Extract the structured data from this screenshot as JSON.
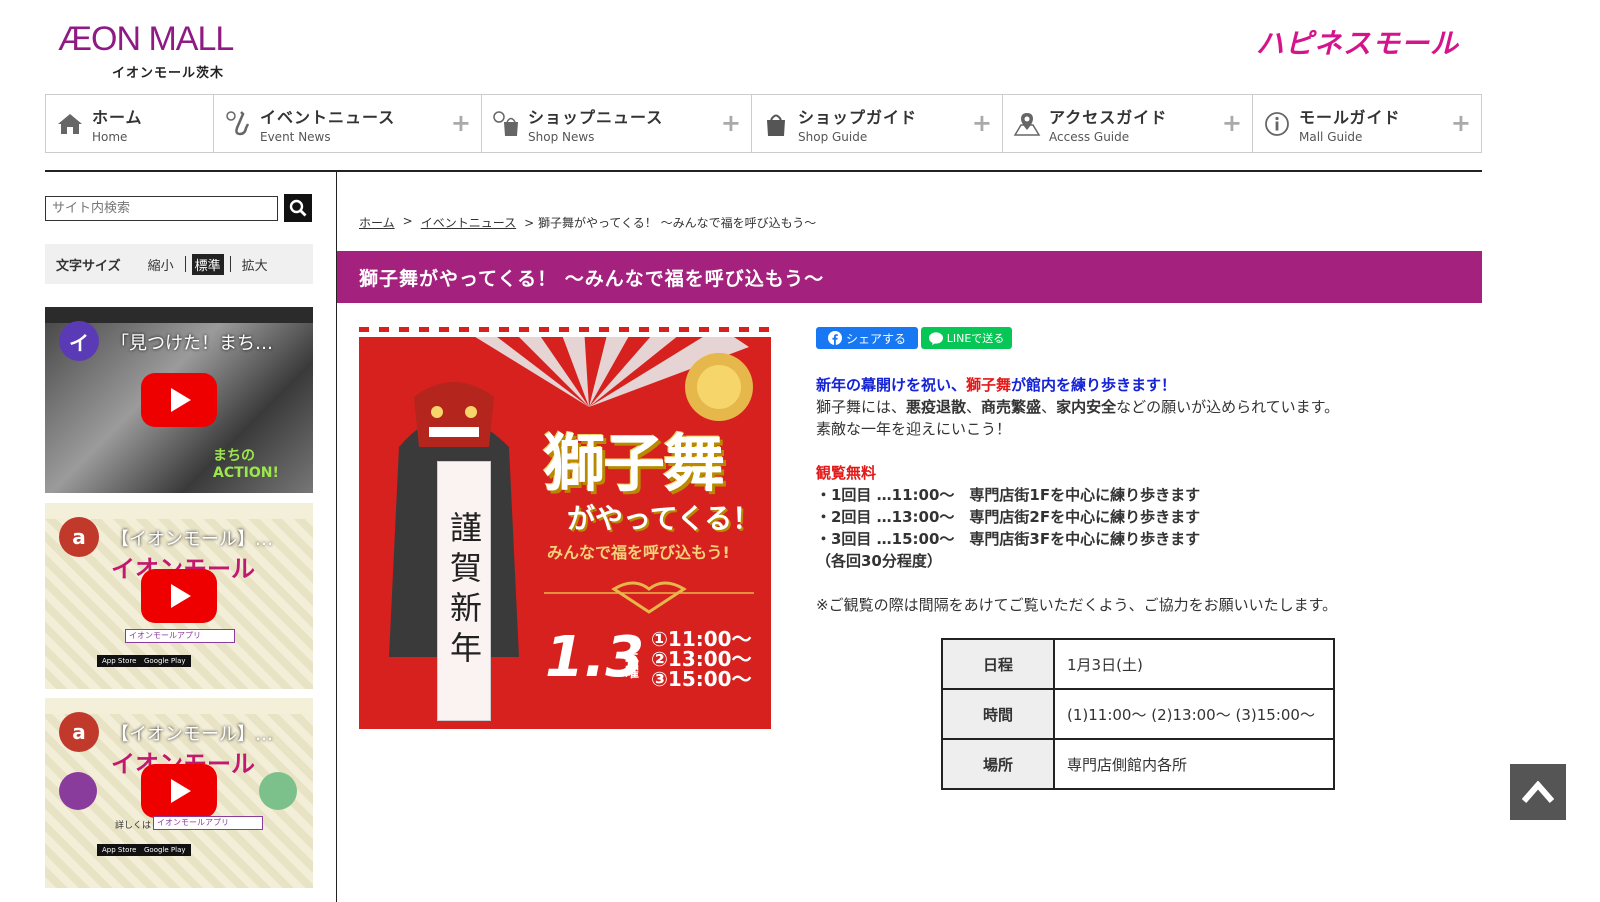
{
  "header": {
    "logo_main": "ÆON MALL",
    "logo_sub": "イオンモール茨木",
    "logo_happiness": "ハピネスモール"
  },
  "global_nav": [
    {
      "ja": "ホーム",
      "en": "Home",
      "icon": "home-icon",
      "plus": ""
    },
    {
      "ja": "イベントニュース",
      "en": "Event News",
      "icon": "saxophone-icon",
      "plus": "+"
    },
    {
      "ja": "ショップニュース",
      "en": "Shop News",
      "icon": "shopping-bag-icon",
      "plus": "+"
    },
    {
      "ja": "ショップガイド",
      "en": "Shop Guide",
      "icon": "shop-bag-icon",
      "plus": "+"
    },
    {
      "ja": "アクセスガイド",
      "en": "Access Guide",
      "icon": "map-pin-icon",
      "plus": "+"
    },
    {
      "ja": "モールガイド",
      "en": "Mall Guide",
      "icon": "info-icon",
      "plus": "+"
    }
  ],
  "sidebar": {
    "search_placeholder": "サイト内検索",
    "font_size": {
      "label": "文字サイズ",
      "small": "縮小",
      "standard": "標準",
      "large": "拡大"
    },
    "videos": [
      {
        "avatar": "イ",
        "avatar_color": "#5b3bb5",
        "title": "「見つけた！まち…",
        "overlay": "まちの ACTION!"
      },
      {
        "avatar": "a",
        "avatar_color": "#c0392b",
        "title": "【イオンモール】…",
        "big": "イオンモール",
        "search": "イオンモールアプリ",
        "store1": "App Store",
        "store2": "Google Play"
      },
      {
        "avatar": "a",
        "avatar_color": "#c0392b",
        "title": "【イオンモール】…",
        "big": "イオンモール",
        "prefix": "詳しくは",
        "search": "イオンモールアプリ",
        "store1": "App Store",
        "store2": "Google Play"
      }
    ]
  },
  "breadcrumb": {
    "home": "ホーム",
    "sep1": ">",
    "event": "イベントニュース",
    "current": "> 獅子舞がやってくる！ 〜みんなで福を呼び込もう〜"
  },
  "article": {
    "title": "獅子舞がやってくる！ 〜みんなで福を呼び込もう〜",
    "poster": {
      "headline": "獅子舞",
      "sub": "がやってくる！",
      "tagline": "みんなで福を呼び込もう!",
      "scroll": "謹賀新年",
      "date": "1.3",
      "dow": "土曜",
      "times": [
        "①11:00〜",
        "②13:00〜",
        "③15:00〜"
      ]
    },
    "share_fb": "シェアする",
    "share_line": "LINEで送る",
    "lead_1": "新年の幕開けを祝い、",
    "lead_2": "獅子舞",
    "lead_3": "が館内を練り歩きます！",
    "p1_a": "獅子舞には、",
    "p1_b": "悪疫退散",
    "p1_c": "、",
    "p1_d": "商売繁盛",
    "p1_e": "、",
    "p1_f": "家内安全",
    "p1_g": "などの願いが込められています。",
    "p2": "素敵な一年を迎えにいこう！",
    "free": "観覧無料",
    "schedule": [
      "・1回目 …11:00〜　専門店街1Fを中心に練り歩きます",
      "・2回目 …13:00〜　専門店街2Fを中心に練り歩きます",
      "・3回目 …15:00〜　専門店街3Fを中心に練り歩きます"
    ],
    "duration": "（各回30分程度）",
    "note": "※ご観覧の際は間隔をあけてご覧いただくよう、ご協力をお願いいたします。",
    "table": [
      {
        "label": "日程",
        "value": "1月3日(土)"
      },
      {
        "label": "時間",
        "value": "(1)11:00〜 (2)13:00〜 (3)15:00〜"
      },
      {
        "label": "場所",
        "value": "専門店側館内各所"
      }
    ]
  },
  "colors": {
    "brand": "#a4217e",
    "lead_blue": "#1523d6",
    "lead_red": "#e31919"
  }
}
